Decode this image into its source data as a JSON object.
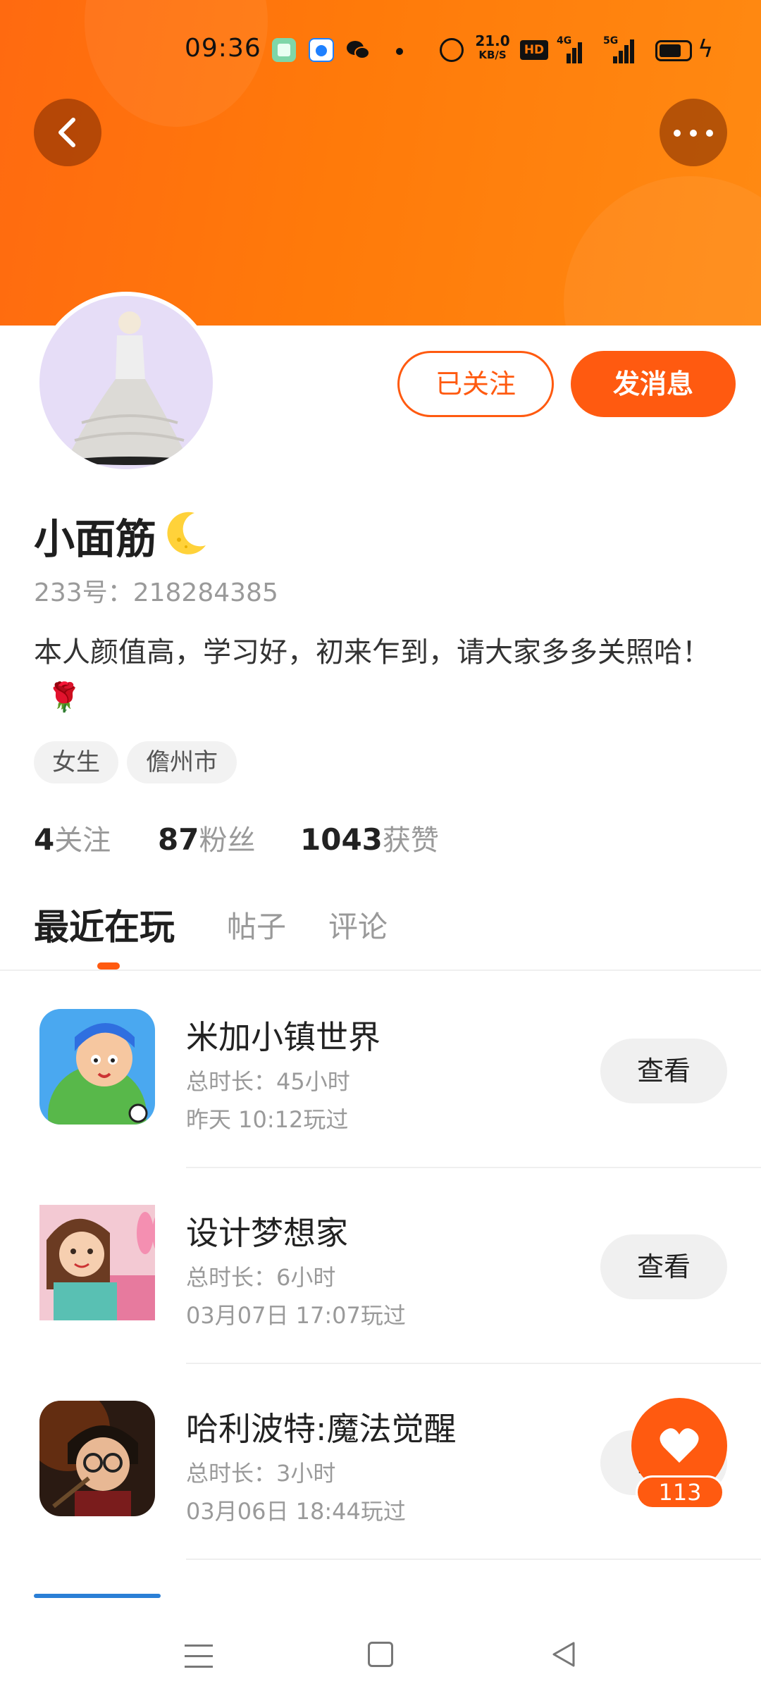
{
  "status_bar": {
    "time": "09:36",
    "net_speed_value": "21.0",
    "net_speed_unit": "KB/S",
    "hd_label": "HD",
    "signal1_label": "4G",
    "signal2_label": "5G"
  },
  "profile": {
    "nickname": "小面筋",
    "id_text": "233号：218284385",
    "bio": "本人颜值高，学习好，初来乍到，请大家多多关照哈！",
    "tags": [
      "女生",
      "儋州市"
    ],
    "follow_button": "已关注",
    "message_button": "发消息"
  },
  "stats": {
    "following_count": "4",
    "following_label": "关注",
    "fans_count": "87",
    "fans_label": "粉丝",
    "likes_count": "1043",
    "likes_label": "获赞"
  },
  "tabs": [
    {
      "label": "最近在玩",
      "active": true
    },
    {
      "label": "帖子",
      "active": false
    },
    {
      "label": "评论",
      "active": false
    }
  ],
  "games": [
    {
      "title": "米加小镇世界",
      "duration": "总时长：45小时",
      "last_played": "昨天 10:12玩过",
      "button": "查看"
    },
    {
      "title": "设计梦想家",
      "duration": "总时长：6小时",
      "last_played": "03月07日 17:07玩过",
      "button": "查看"
    },
    {
      "title": "哈利波特:魔法觉醒",
      "duration": "总时长：3小时",
      "last_played": "03月06日 18:44玩过",
      "button": "查看"
    }
  ],
  "like_fab": {
    "count": "113"
  },
  "colors": {
    "accent": "#ff5a10",
    "header_gradient_start": "#ff6a10",
    "header_gradient_end": "#ff8a12"
  },
  "icons": [
    "back-arrow-icon",
    "more-dots-icon",
    "moon-icon",
    "rose-icon",
    "heart-icon",
    "menu-icon",
    "home-icon",
    "back-triangle-icon"
  ]
}
